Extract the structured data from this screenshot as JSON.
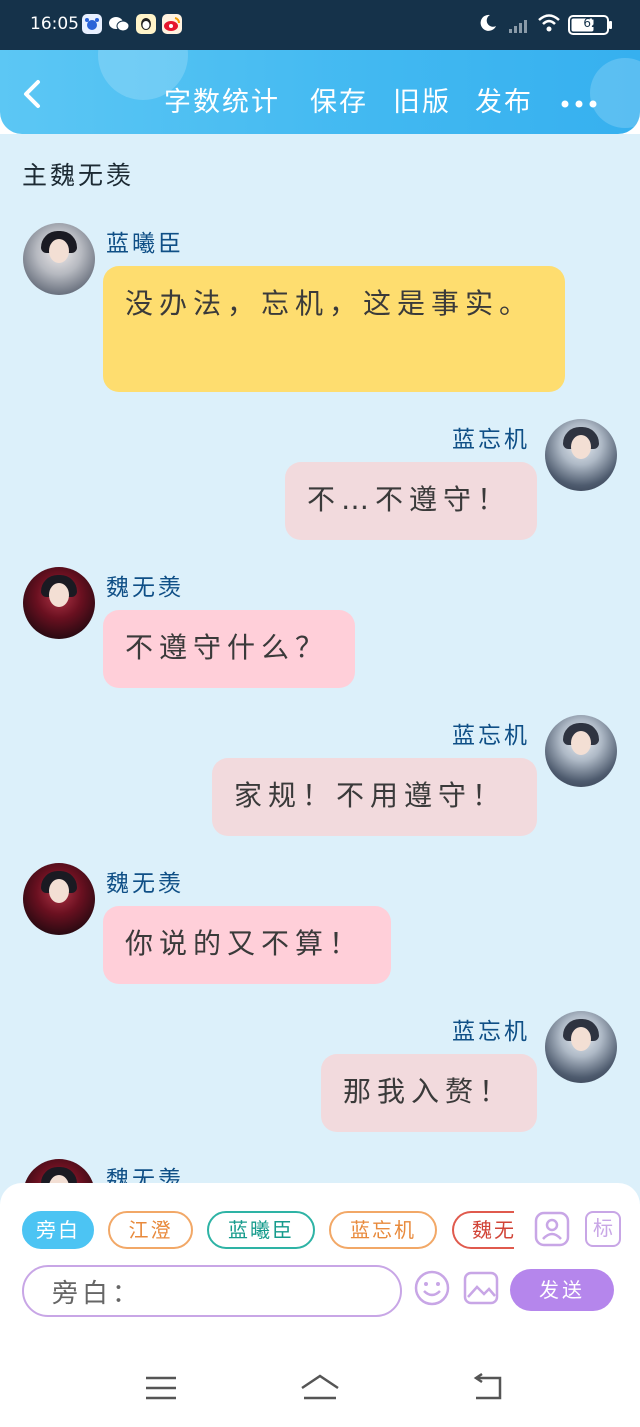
{
  "status_bar": {
    "time": "16:05",
    "battery": "62",
    "app_icons": [
      "baidu-icon",
      "wechat-icon",
      "qq-icon",
      "weibo-icon"
    ],
    "right_icons": [
      "moon-icon",
      "signal-icon",
      "wifi-icon",
      "battery-icon"
    ]
  },
  "header": {
    "back_icon": "chevron-left-icon",
    "actions": [
      "字数统计",
      "保存",
      "旧版",
      "发布"
    ],
    "more_icon": "more-dots-icon",
    "gradient": [
      "#5cc7f4",
      "#36b0ef"
    ]
  },
  "main_character_label": "主魏无羡",
  "messages": [
    {
      "side": "left",
      "name": "蓝曦臣",
      "text": "没办法，忘机，这是事实。",
      "bubble_color": "#fedd6f"
    },
    {
      "side": "right",
      "name": "蓝忘机",
      "text": "不…不遵守！",
      "bubble_color": "#f2dadd"
    },
    {
      "side": "left",
      "name": "魏无羡",
      "text": "不遵守什么？",
      "bubble_color": "#ffcfd9"
    },
    {
      "side": "right",
      "name": "蓝忘机",
      "text": "家规！不用遵守！",
      "bubble_color": "#f2dadd"
    },
    {
      "side": "left",
      "name": "魏无羡",
      "text": "你说的又不算！",
      "bubble_color": "#ffcfd9"
    },
    {
      "side": "right",
      "name": "蓝忘机",
      "text": "那我入赘！",
      "bubble_color": "#f2dadd"
    },
    {
      "side": "left",
      "name": "魏无羡",
      "text": "",
      "bubble_color": "#ffcfd9"
    }
  ],
  "input_panel": {
    "role_chips": [
      "旁白",
      "江澄",
      "蓝曦臣",
      "蓝忘机",
      "魏无"
    ],
    "active_chip": "旁白",
    "contact_icon": "contact-card-icon",
    "tag_label": "标",
    "input_value": "旁白：",
    "emoji_icon": "emoji-icon",
    "image_icon": "image-icon",
    "send_label": "发送",
    "send_color": "#b586ec"
  },
  "nav_bar": {
    "icons": [
      "menu-icon",
      "home-icon",
      "back-icon"
    ]
  }
}
